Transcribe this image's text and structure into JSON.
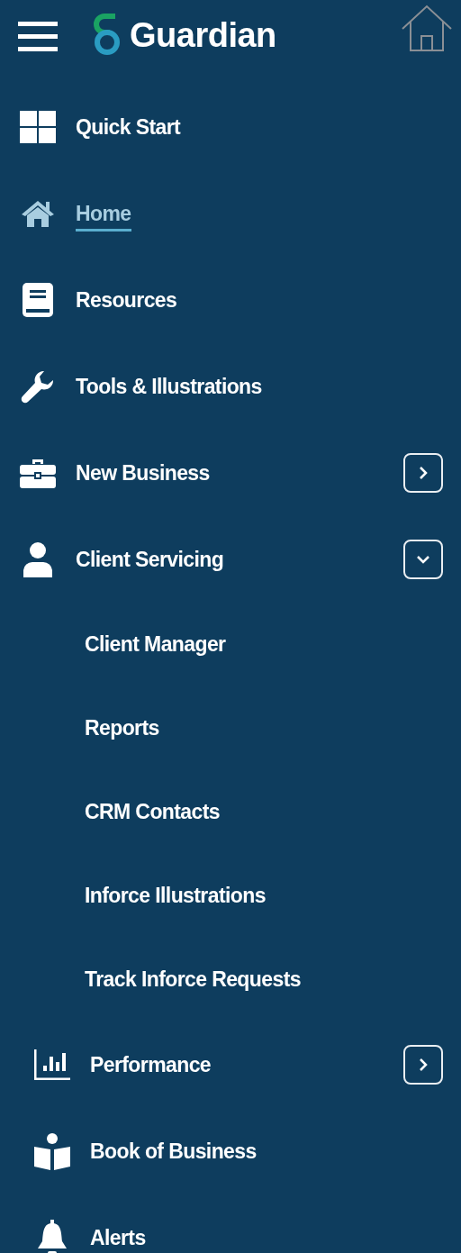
{
  "header": {
    "brand": "Guardian"
  },
  "nav_items": [
    {
      "label": "Quick Start",
      "selected": false
    },
    {
      "label": "Home",
      "selected": true
    },
    {
      "label": "Resources",
      "selected": false
    },
    {
      "label": "Tools & Illustrations",
      "selected": false
    },
    {
      "label": "New Business",
      "selected": false,
      "expanded": false
    },
    {
      "label": "Client Servicing",
      "selected": false,
      "expanded": true,
      "children": [
        {
          "label": "Client Manager"
        },
        {
          "label": "Reports"
        },
        {
          "label": "CRM Contacts"
        },
        {
          "label": "Inforce Illustrations"
        },
        {
          "label": "Track Inforce Requests"
        }
      ]
    }
  ],
  "more_items": [
    {
      "label": "Performance",
      "expanded": false
    },
    {
      "label": "Book of Business"
    },
    {
      "label": "Alerts"
    }
  ]
}
